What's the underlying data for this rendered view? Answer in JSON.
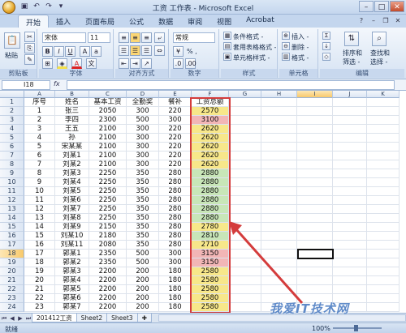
{
  "window": {
    "title": "工资 工作表 - Microsoft Excel"
  },
  "ribbon": {
    "tabs": [
      "开始",
      "插入",
      "页面布局",
      "公式",
      "数据",
      "审阅",
      "视图",
      "Acrobat"
    ],
    "clipboard": {
      "paste": "粘贴",
      "label": "剪贴板"
    },
    "font": {
      "name": "宋体",
      "size": "11",
      "label": "字体"
    },
    "alignment": {
      "label": "对齐方式"
    },
    "number": {
      "format": "常规",
      "percent": "% ,",
      "label": "数字"
    },
    "styles": {
      "cond": "条件格式 -",
      "table": "套用表格格式 -",
      "cell": "单元格样式 -",
      "label": "样式"
    },
    "cells": {
      "insert": "插入 -",
      "delete": "删除 -",
      "format": "格式 -",
      "label": "单元格"
    },
    "editing": {
      "sort": "排序和",
      "filter": "筛选 -",
      "find": "查找和",
      "select": "选择 -",
      "label": "编辑"
    }
  },
  "formula_bar": {
    "name_box": "I18",
    "fx": "fx",
    "value": ""
  },
  "grid": {
    "columns": [
      "A",
      "B",
      "C",
      "D",
      "E",
      "F",
      "G",
      "H",
      "I",
      "J",
      "K"
    ],
    "selected_col": "I",
    "selected_row": 18,
    "headers": [
      "序号",
      "姓名",
      "基本工资",
      "全勤奖",
      "餐补",
      "工资总额"
    ],
    "rows": [
      {
        "no": "1",
        "name": "张三",
        "base": "2050",
        "bonus": "300",
        "meal": "220",
        "total": "2570",
        "color": "yellow"
      },
      {
        "no": "2",
        "name": "李四",
        "base": "2300",
        "bonus": "500",
        "meal": "300",
        "total": "3100",
        "color": "pink"
      },
      {
        "no": "3",
        "name": "王五",
        "base": "2100",
        "bonus": "300",
        "meal": "220",
        "total": "2620",
        "color": "yellow"
      },
      {
        "no": "4",
        "name": "孙",
        "base": "2100",
        "bonus": "300",
        "meal": "220",
        "total": "2620",
        "color": "yellow"
      },
      {
        "no": "5",
        "name": "宋某某",
        "base": "2100",
        "bonus": "300",
        "meal": "220",
        "total": "2620",
        "color": "yellow"
      },
      {
        "no": "6",
        "name": "刘某1",
        "base": "2100",
        "bonus": "300",
        "meal": "220",
        "total": "2620",
        "color": "yellow"
      },
      {
        "no": "7",
        "name": "刘某2",
        "base": "2100",
        "bonus": "300",
        "meal": "220",
        "total": "2620",
        "color": "yellow"
      },
      {
        "no": "8",
        "name": "刘某3",
        "base": "2250",
        "bonus": "350",
        "meal": "280",
        "total": "2880",
        "color": "green"
      },
      {
        "no": "9",
        "name": "刘某4",
        "base": "2250",
        "bonus": "350",
        "meal": "280",
        "total": "2880",
        "color": "green"
      },
      {
        "no": "10",
        "name": "刘某5",
        "base": "2250",
        "bonus": "350",
        "meal": "280",
        "total": "2880",
        "color": "green"
      },
      {
        "no": "11",
        "name": "刘某6",
        "base": "2250",
        "bonus": "350",
        "meal": "280",
        "total": "2880",
        "color": "green"
      },
      {
        "no": "12",
        "name": "刘某7",
        "base": "2250",
        "bonus": "350",
        "meal": "280",
        "total": "2880",
        "color": "green"
      },
      {
        "no": "13",
        "name": "刘某8",
        "base": "2250",
        "bonus": "350",
        "meal": "280",
        "total": "2880",
        "color": "green"
      },
      {
        "no": "14",
        "name": "刘某9",
        "base": "2150",
        "bonus": "350",
        "meal": "280",
        "total": "2780",
        "color": "yellow"
      },
      {
        "no": "15",
        "name": "刘某10",
        "base": "2180",
        "bonus": "350",
        "meal": "280",
        "total": "2810",
        "color": "green"
      },
      {
        "no": "16",
        "name": "刘某11",
        "base": "2080",
        "bonus": "350",
        "meal": "280",
        "total": "2710",
        "color": "yellow"
      },
      {
        "no": "17",
        "name": "郭某1",
        "base": "2350",
        "bonus": "500",
        "meal": "300",
        "total": "3150",
        "color": "pink"
      },
      {
        "no": "18",
        "name": "郭某2",
        "base": "2350",
        "bonus": "500",
        "meal": "300",
        "total": "3150",
        "color": "pink"
      },
      {
        "no": "19",
        "name": "郭某3",
        "base": "2200",
        "bonus": "200",
        "meal": "180",
        "total": "2580",
        "color": "yellow"
      },
      {
        "no": "20",
        "name": "郭某4",
        "base": "2200",
        "bonus": "200",
        "meal": "180",
        "total": "2580",
        "color": "yellow"
      },
      {
        "no": "21",
        "name": "郭某5",
        "base": "2200",
        "bonus": "200",
        "meal": "180",
        "total": "2580",
        "color": "yellow"
      },
      {
        "no": "22",
        "name": "郭某6",
        "base": "2200",
        "bonus": "200",
        "meal": "180",
        "total": "2580",
        "color": "yellow"
      },
      {
        "no": "23",
        "name": "郭某7",
        "base": "2200",
        "bonus": "200",
        "meal": "180",
        "total": "2580",
        "color": "yellow"
      }
    ]
  },
  "sheets": [
    "201412工资",
    "Sheet2",
    "Sheet3"
  ],
  "active_sheet": "201412工资",
  "status": {
    "text": "就绪",
    "zoom": "100%"
  },
  "colors": {
    "highlight_box": "#d43c3c",
    "arrow": "#d43c3c",
    "yellow": "#f7e78a",
    "pink": "#f2b6b6",
    "green": "#c8e6b8"
  },
  "watermark": "我爱IT技术网"
}
